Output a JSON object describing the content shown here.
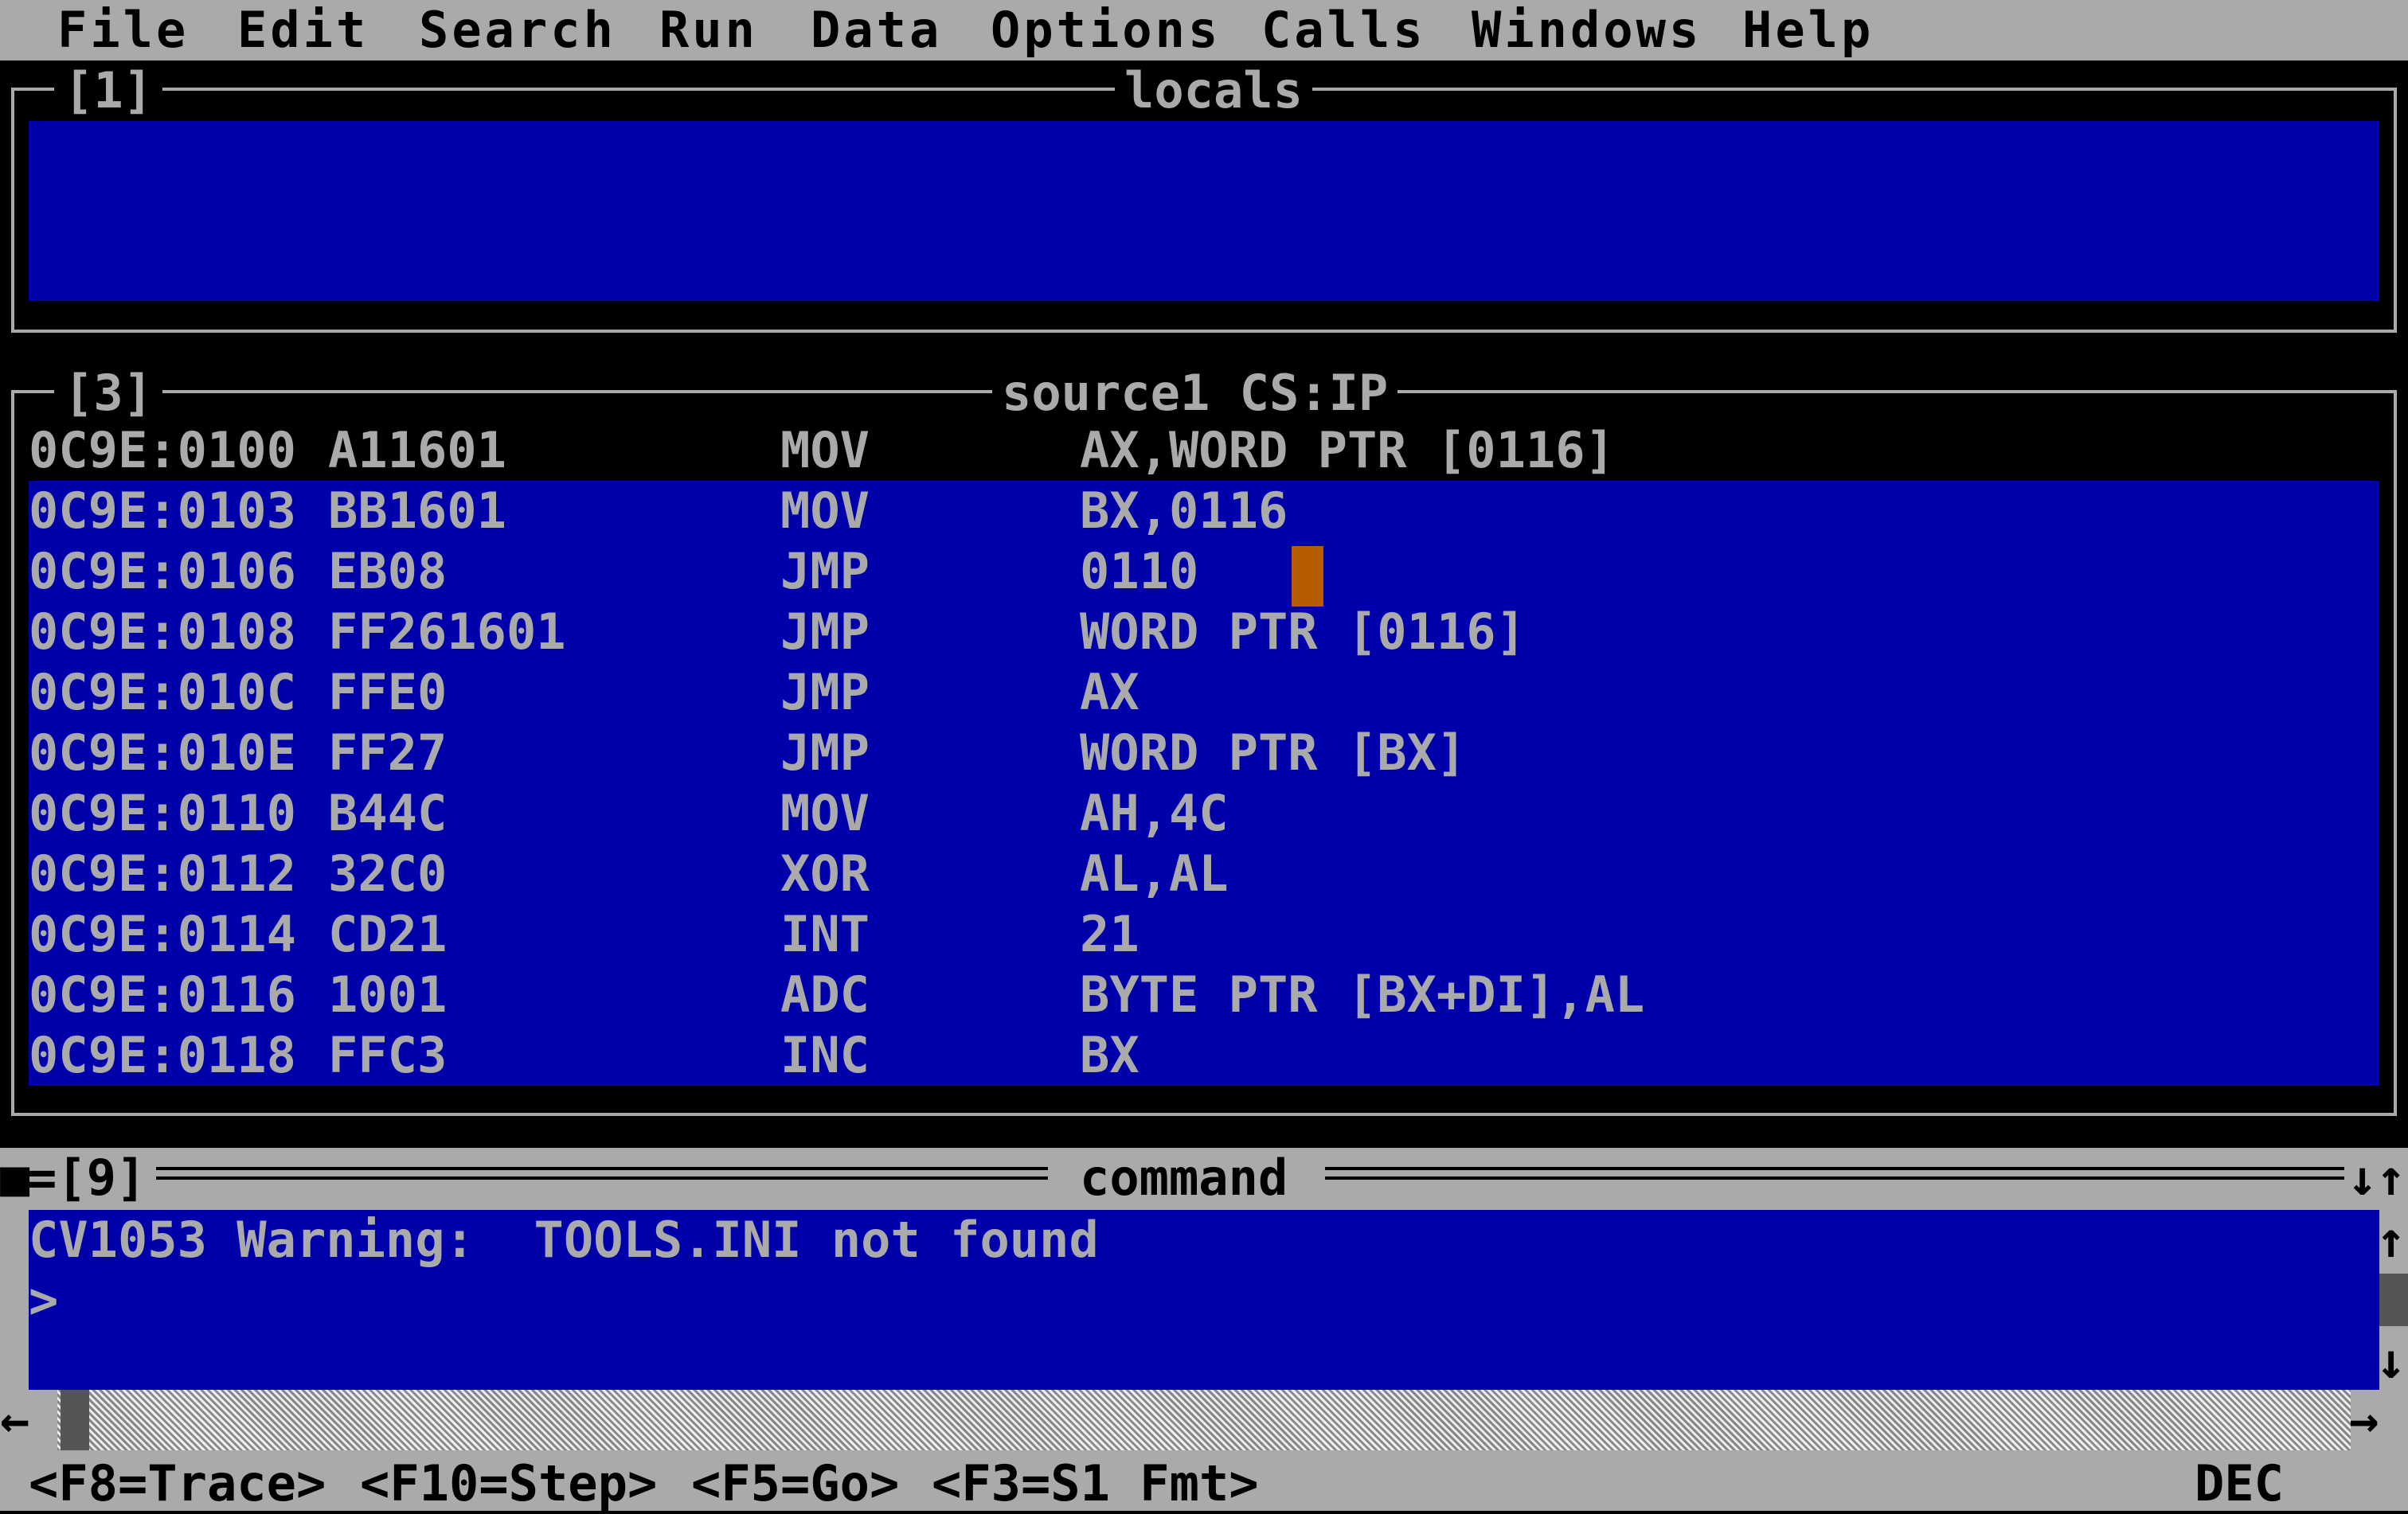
{
  "menu": {
    "items": [
      "File",
      "Edit",
      "Search",
      "Run",
      "Data",
      "Options",
      "Calls",
      "Windows",
      "Help"
    ]
  },
  "locals_window": {
    "number": "[1]",
    "title": "locals"
  },
  "source_window": {
    "number": "[3]",
    "title": "source1 CS:IP",
    "rows": [
      {
        "addr": "0C9E:0100",
        "bytes": "A11601",
        "op": "MOV",
        "args": "AX,WORD PTR [0116]"
      },
      {
        "addr": "0C9E:0103",
        "bytes": "BB1601",
        "op": "MOV",
        "args": "BX,0116"
      },
      {
        "addr": "0C9E:0106",
        "bytes": "EB08",
        "op": "JMP",
        "args": "0110"
      },
      {
        "addr": "0C9E:0108",
        "bytes": "FF261601",
        "op": "JMP",
        "args": "WORD PTR [0116]"
      },
      {
        "addr": "0C9E:010C",
        "bytes": "FFE0",
        "op": "JMP",
        "args": "AX"
      },
      {
        "addr": "0C9E:010E",
        "bytes": "FF27",
        "op": "JMP",
        "args": "WORD PTR [BX]"
      },
      {
        "addr": "0C9E:0110",
        "bytes": "B44C",
        "op": "MOV",
        "args": "AH,4C"
      },
      {
        "addr": "0C9E:0112",
        "bytes": "32C0",
        "op": "XOR",
        "args": "AL,AL"
      },
      {
        "addr": "0C9E:0114",
        "bytes": "CD21",
        "op": "INT",
        "args": "21"
      },
      {
        "addr": "0C9E:0116",
        "bytes": "1001",
        "op": "ADC",
        "args": "BYTE PTR [BX+DI],AL"
      },
      {
        "addr": "0C9E:0118",
        "bytes": "FFC3",
        "op": "INC",
        "args": "BX"
      }
    ]
  },
  "command_window": {
    "number": "=[9]",
    "title": "command",
    "warning": "CV1053 Warning:  TOOLS.INI not found",
    "prompt": ">"
  },
  "status": {
    "keys": [
      "<F8=Trace>",
      "<F10=Step>",
      "<F5=Go>",
      "<F3=S1 Fmt>"
    ],
    "radix": "DEC"
  },
  "colors": {
    "panel": "#0000aa",
    "chrome": "#aaaaaa",
    "cursor": "#b85c00"
  }
}
